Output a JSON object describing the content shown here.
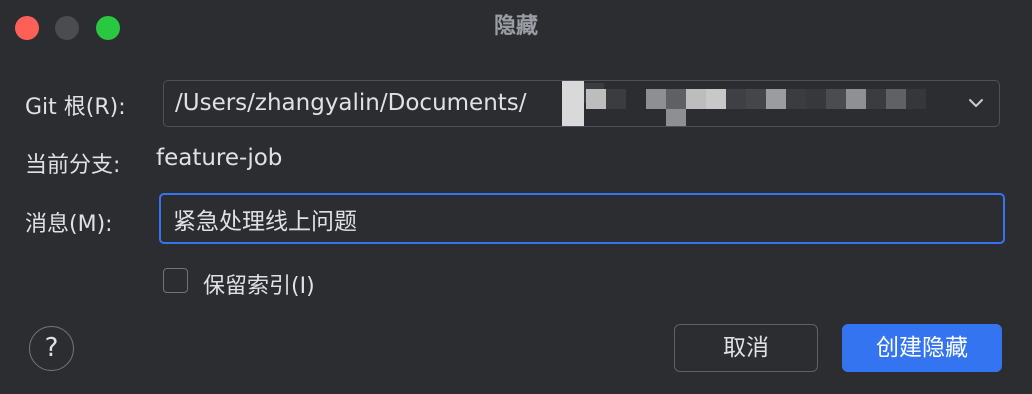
{
  "window": {
    "title": "隐藏"
  },
  "form": {
    "git_root_label": "Git 根(R):",
    "git_root_value": "/Users/zhangyalin/Documents/",
    "branch_label": "当前分支:",
    "branch_value": "feature-job",
    "message_label": "消息(M):",
    "message_value": "紧急处理线上问题",
    "keep_index_label": "保留索引(I)",
    "keep_index_checked": false
  },
  "footer": {
    "help_glyph": "?",
    "cancel_label": "取消",
    "confirm_label": "创建隐藏"
  },
  "icons": {
    "combo_dropdown": "chevron-down-icon",
    "help": "help-icon"
  },
  "colors": {
    "background": "#2b2d30",
    "accent": "#3574f0",
    "close": "#fe5f57",
    "zoom": "#28c840",
    "minimize_inactive": "#4a4c50"
  }
}
